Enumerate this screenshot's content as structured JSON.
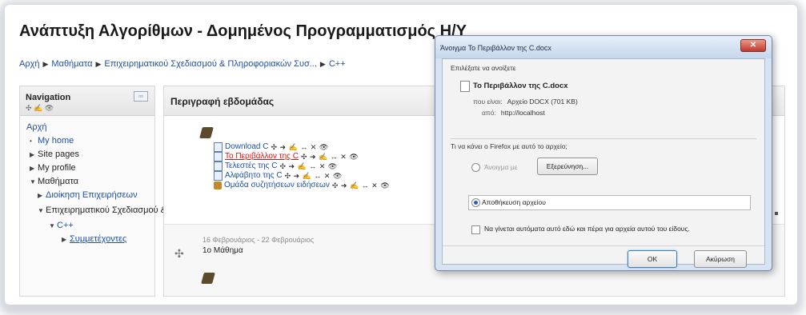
{
  "page": {
    "title": "Ανάπτυξη Αλγορίθμων - Δομημένος Προγραμματισμός Η/Υ",
    "breadcrumb": [
      "Αρχή",
      "Μαθήματα",
      "Επιχειρηματικού Σχεδιασμού & Πληροφοριακών Συσ...",
      "C++"
    ]
  },
  "navigation": {
    "title": "Navigation",
    "items": [
      {
        "label": "Αρχή"
      },
      {
        "label": "My home"
      },
      {
        "label": "Site pages"
      },
      {
        "label": "My profile"
      },
      {
        "label": "Μαθήματα"
      },
      {
        "label": "Διοίκηση Επιχειρήσεων"
      },
      {
        "label": "Επιχειρηματικού Σχεδιασμού & Πληροφοριακών Συσ..."
      },
      {
        "label": "C++"
      },
      {
        "label": "Συμμετέχοντες"
      }
    ]
  },
  "main": {
    "header": "Περιγραφή εβδομάδας",
    "resources": [
      {
        "label": "Download C"
      },
      {
        "label": "Το Περιβάλλον της C"
      },
      {
        "label": "Τελεστές της C"
      },
      {
        "label": "Αλφάβητο της C"
      },
      {
        "label": "Ομάδα συζητήσεων ειδήσεων"
      }
    ],
    "tools_glyphs": "✣ ➜ ✍ ↔ ✕ 👁 ",
    "week1": {
      "date": "16 Φεβρουάριος - 22 Φεβρουάριος",
      "title": "1ο Μάθημα"
    }
  },
  "dialog": {
    "title": "Άνοιγμα Το Περιβάλλον της C.docx",
    "close": "✕",
    "prompt": "Επιλέξατε να ανοίξετε",
    "file_name": "Το Περιβάλλον της C.docx",
    "type_label": "που είναι:",
    "type_value": "Αρχείο DOCX (701 KB)",
    "from_label": "από:",
    "from_value": "http://localhost",
    "question": "Τι να κάνει ο Firefox με αυτό το αρχείο;",
    "open_with_label": "Άνοιγμα με",
    "browse_button": "Εξερεύνηση...",
    "save_label": "Αποθήκευση αρχείου",
    "auto_checkbox_label": "Να γίνεται αυτόματα αυτό εδώ και πέρα για αρχεία αυτού του είδους.",
    "ok_button": "OK",
    "cancel_button": "Ακύρωση"
  }
}
